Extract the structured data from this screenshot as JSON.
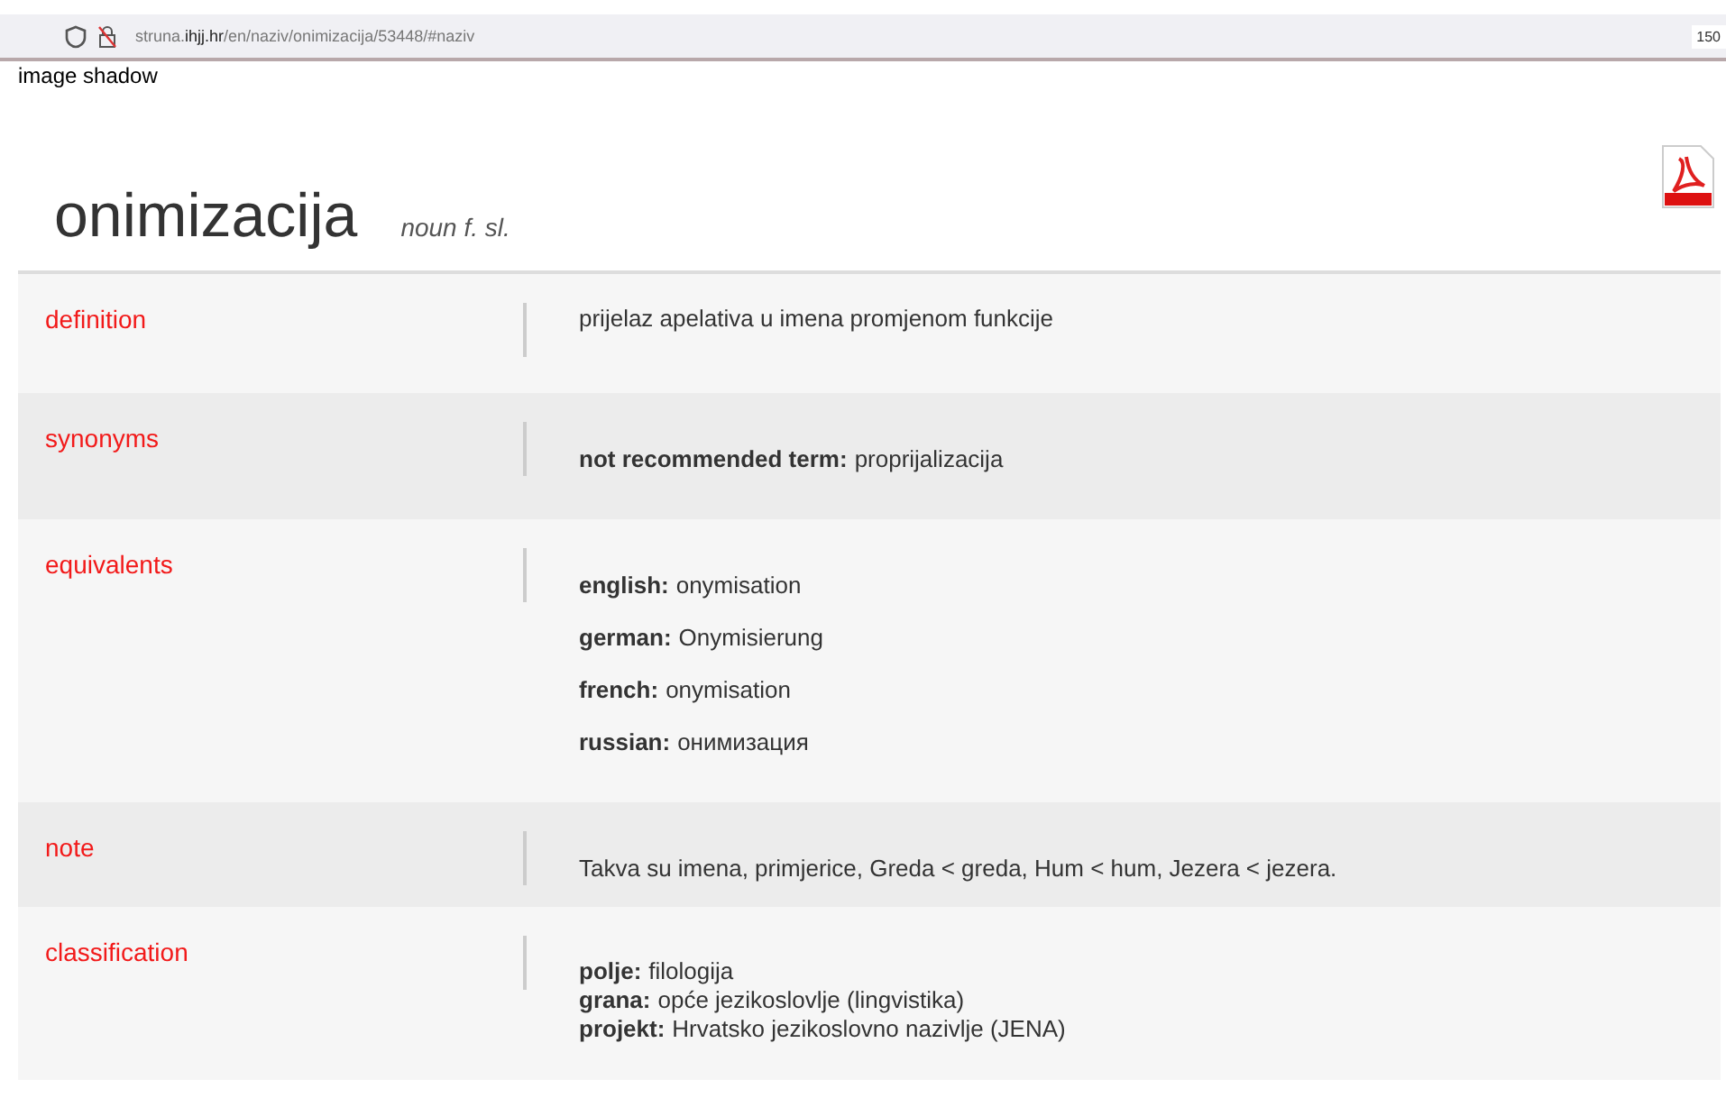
{
  "browser": {
    "url": "struna.**ihjj.hr**/en/naziv/onimizacija/53448/#naziv",
    "zoom": "150"
  },
  "image_alt": "image shadow",
  "term": {
    "title": "onimizacija",
    "grammar": "noun f. sl."
  },
  "sections": [
    {
      "label": "definition",
      "kind": "text",
      "lines": [
        {
          "value": "prijelaz apelativa u imena promjenom funkcije"
        }
      ]
    },
    {
      "label": "synonyms",
      "kind": "spaced",
      "lines": [
        {
          "term": "not recommended term:",
          "value": "proprijalizacija"
        }
      ]
    },
    {
      "label": "equivalents",
      "kind": "spaced",
      "lines": [
        {
          "term": "english:",
          "value": "onymisation"
        },
        {
          "term": "german:",
          "value": "Onymisierung"
        },
        {
          "term": "french:",
          "value": "onymisation"
        },
        {
          "term": "russian:",
          "value": "онимизация"
        }
      ]
    },
    {
      "label": "note",
      "kind": "short",
      "lines": [
        {
          "value": "Takva su imena, primjerice, Greda < greda, Hum < hum, Jezera < jezera."
        }
      ]
    },
    {
      "label": "classification",
      "kind": "compact",
      "lines": [
        {
          "term": "polje:",
          "value": "filologija"
        },
        {
          "term": "grana:",
          "value": "opće jezikoslovlje (lingvistika)"
        },
        {
          "term": "projekt:",
          "value": "Hrvatsko jezikoslovno nazivlje (JENA)"
        }
      ]
    }
  ]
}
